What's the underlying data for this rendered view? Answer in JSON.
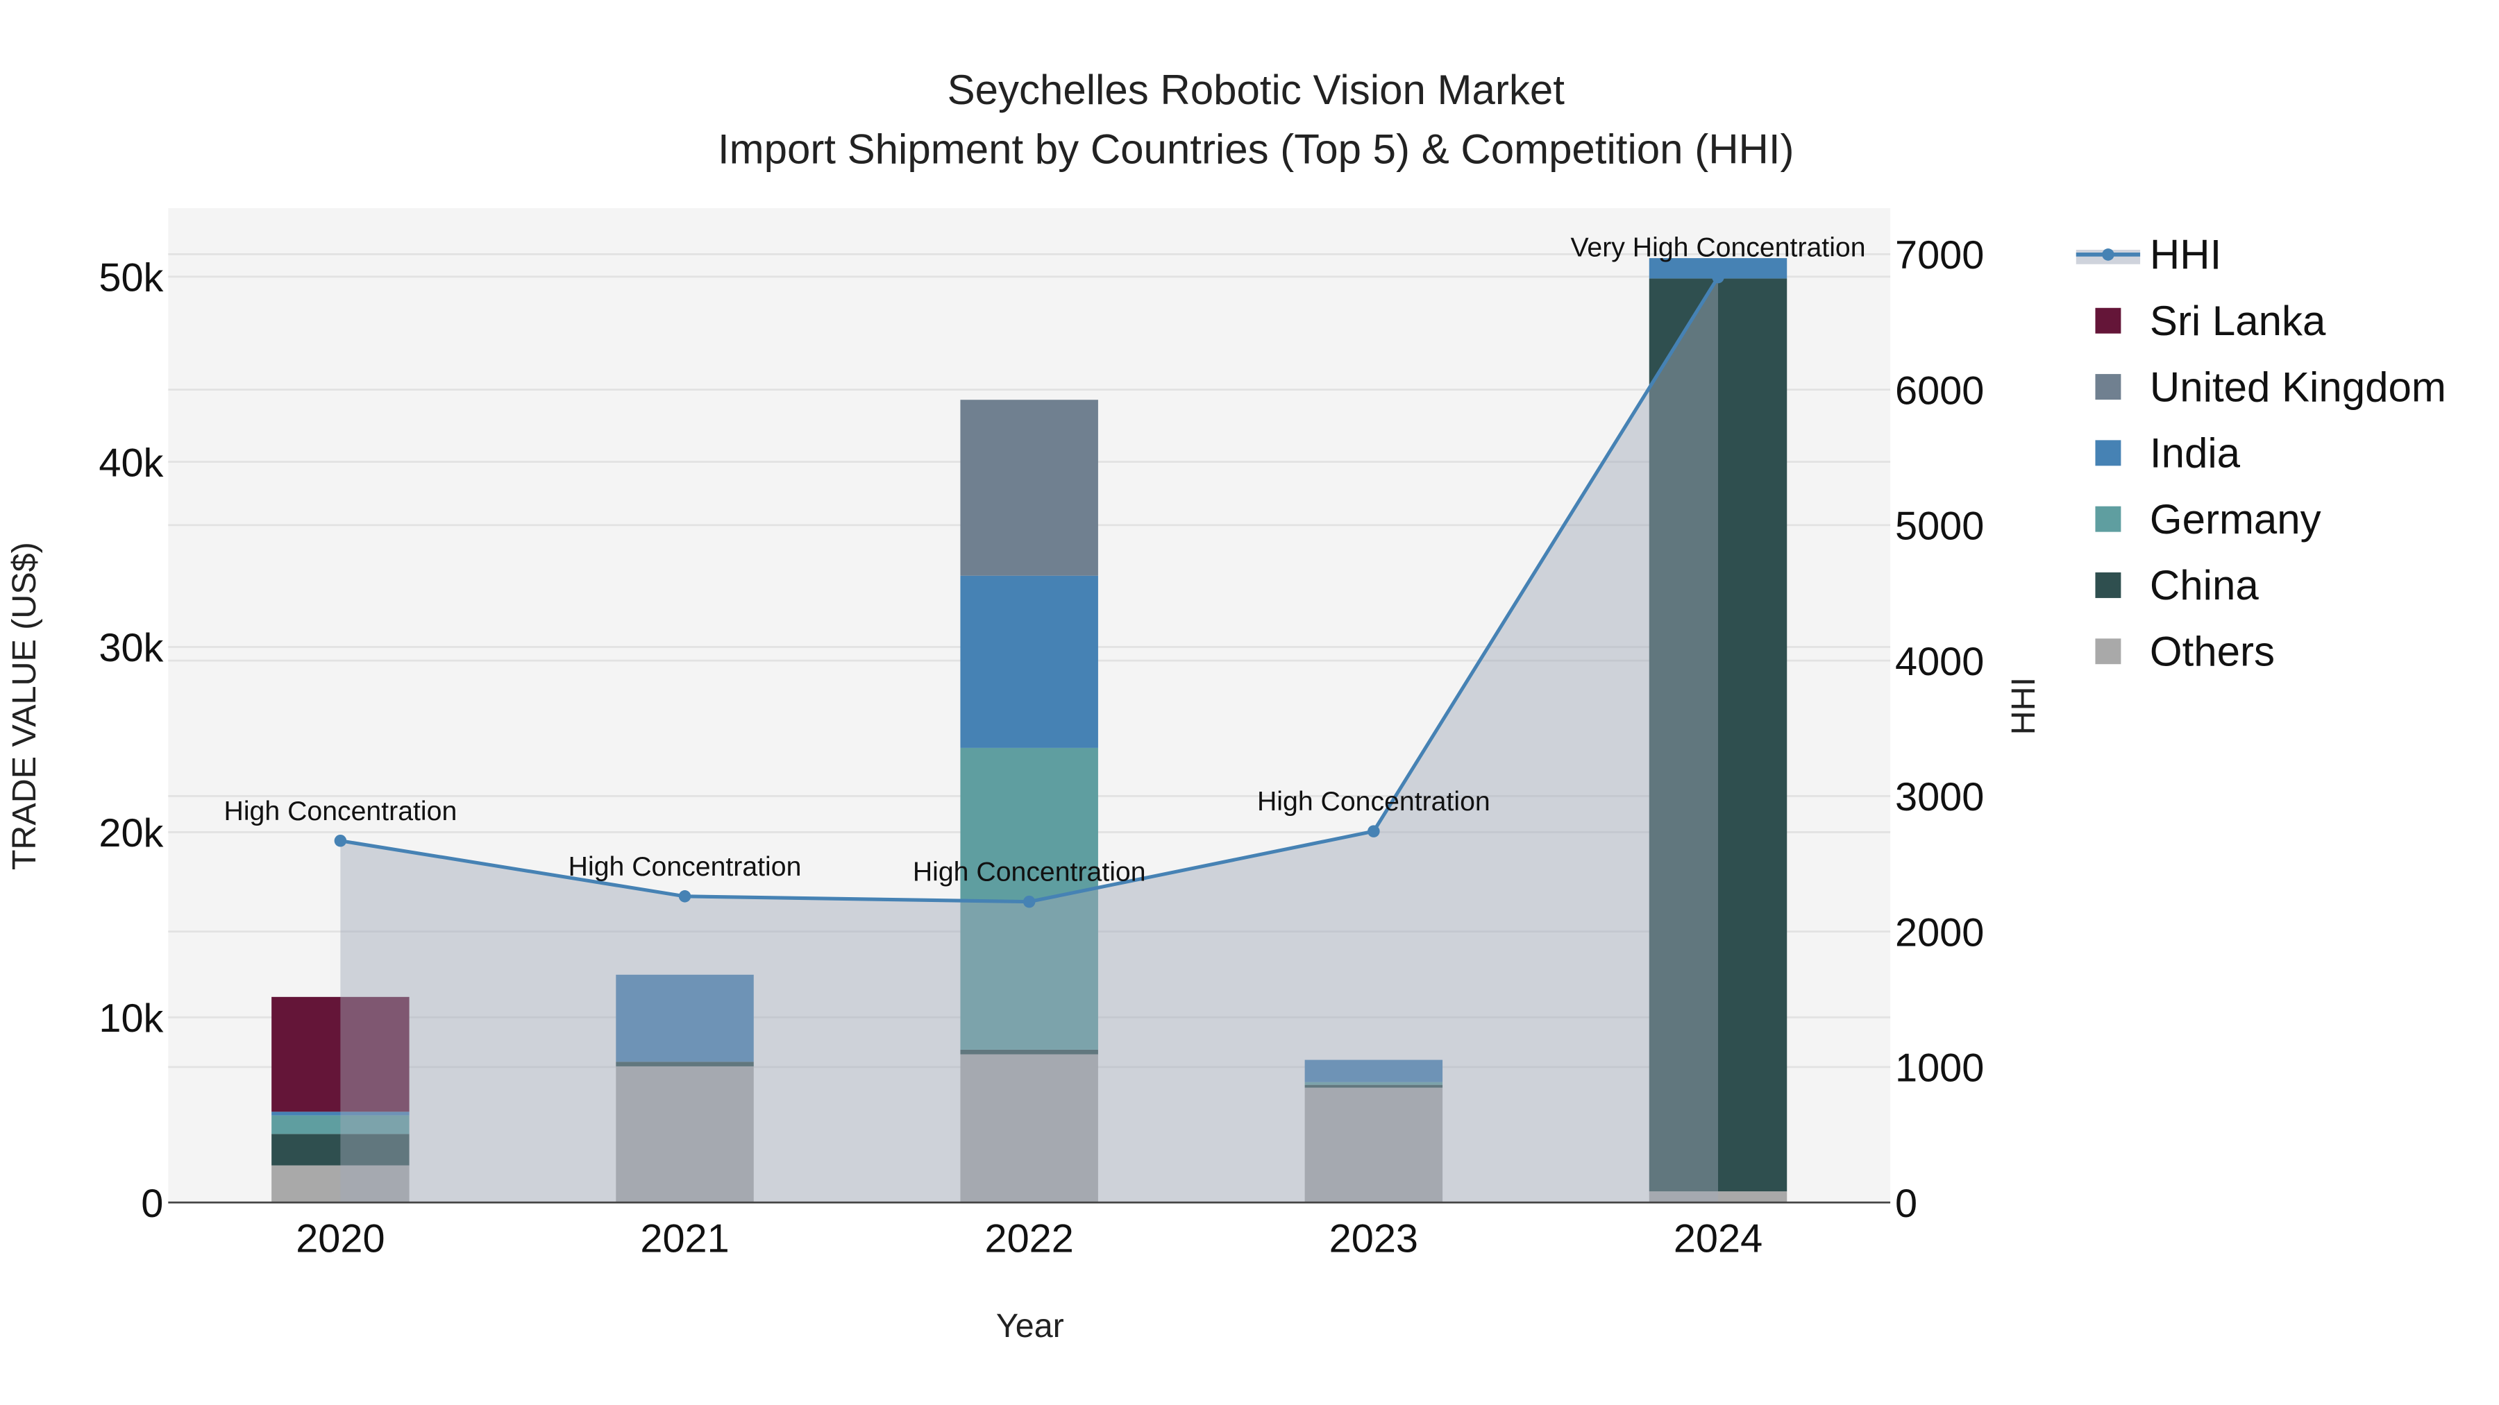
{
  "chart_data": {
    "type": "bar",
    "title": "Seychelles Robotic Vision Market",
    "subtitle": "Import Shipment by Countries (Top 5) & Competition (HHI)",
    "xlabel": "Year",
    "ylabel": "TRADE VALUE (US$)",
    "y2label": "HHI",
    "categories": [
      "2020",
      "2021",
      "2022",
      "2023",
      "2024"
    ],
    "ylim": [
      0,
      53700
    ],
    "y2lim": [
      0,
      7340
    ],
    "yticks": [
      0,
      10000,
      20000,
      30000,
      40000,
      50000
    ],
    "yticklabels": [
      "0",
      "10k",
      "20k",
      "30k",
      "40k",
      "50k"
    ],
    "y2ticks": [
      0,
      1000,
      2000,
      3000,
      4000,
      5000,
      6000,
      7000
    ],
    "y2ticklabels": [
      "0",
      "1000",
      "2000",
      "3000",
      "4000",
      "5000",
      "6000",
      "7000"
    ],
    "stacked": true,
    "grid": true,
    "legend_placement": "right",
    "series": [
      {
        "name": "Others",
        "color": "#a9a9a9",
        "values": [
          2000,
          7350,
          8000,
          6200,
          600
        ]
      },
      {
        "name": "China",
        "color": "#2f4f4f",
        "values": [
          1700,
          250,
          250,
          150,
          49300
        ]
      },
      {
        "name": "Germany",
        "color": "#5f9ea0",
        "values": [
          1000,
          0,
          16300,
          150,
          0
        ]
      },
      {
        "name": "India",
        "color": "#4682b4",
        "values": [
          200,
          4700,
          9300,
          1200,
          1100
        ]
      },
      {
        "name": "United Kingdom",
        "color": "#708090",
        "values": [
          0,
          0,
          9500,
          0,
          0
        ]
      },
      {
        "name": "Sri Lanka",
        "color": "#641538",
        "values": [
          6200,
          0,
          0,
          0,
          0
        ]
      }
    ],
    "hhi": {
      "name": "HHI",
      "color": "#4682b4",
      "values": [
        2670,
        2260,
        2220,
        2740,
        6830
      ],
      "annotations": [
        "High Concentration",
        "High Concentration",
        "High Concentration",
        "High Concentration",
        "Very High Concentration"
      ]
    },
    "legend_order": [
      "HHI",
      "Sri Lanka",
      "United Kingdom",
      "India",
      "Germany",
      "China",
      "Others"
    ]
  }
}
